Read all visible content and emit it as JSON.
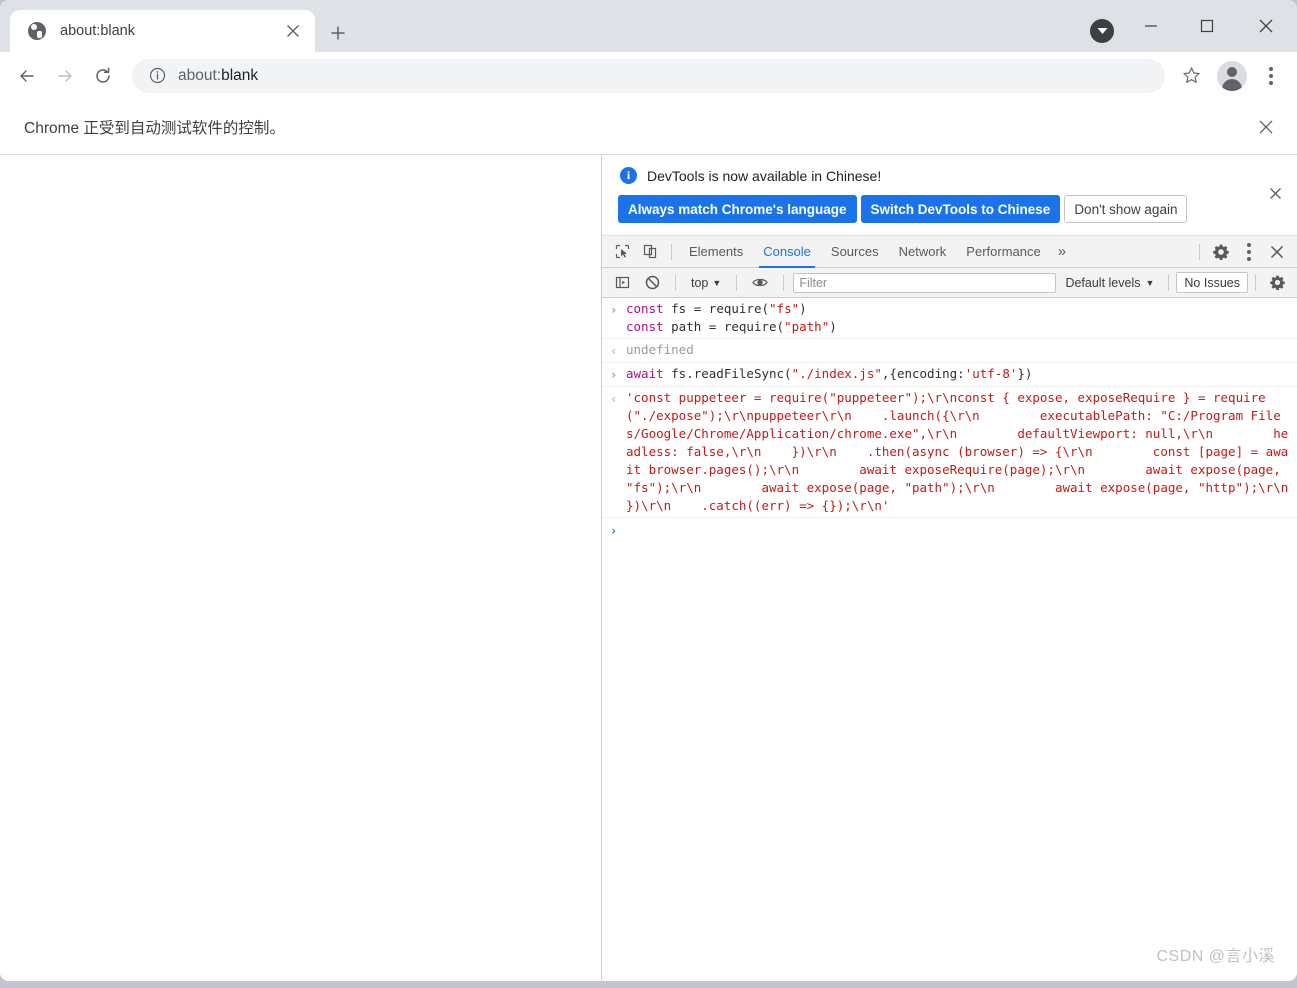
{
  "browser": {
    "tab": {
      "title": "about:blank",
      "favicon": "globe-icon",
      "close_label": "×"
    },
    "new_tab_label": "+",
    "window_controls": {
      "minimize": "—",
      "maximize": "□",
      "close": "×"
    },
    "toolbar": {
      "back": "←",
      "forward": "→",
      "reload": "⟳",
      "site_info_icon": "info-circle-icon",
      "url_scheme": "about:",
      "url_rest": "blank",
      "url_full": "about:blank",
      "bookmark_icon": "star-icon",
      "profile_icon": "avatar-icon",
      "menu_icon": "three-dot-menu-icon"
    },
    "infobar": {
      "message": "Chrome 正受到自动测试软件的控制。",
      "close_label": "×"
    }
  },
  "devtools": {
    "notification": {
      "message": "DevTools is now available in Chinese!",
      "info_icon_label": "i",
      "buttons": [
        {
          "label": "Always match Chrome's language",
          "style": "primary"
        },
        {
          "label": "Switch DevTools to Chinese",
          "style": "primary"
        },
        {
          "label": "Don't show again",
          "style": "secondary"
        }
      ],
      "close_label": "×"
    },
    "tabbar": {
      "inspect_icon": "inspect-element-icon",
      "device_icon": "device-toolbar-icon",
      "tabs": [
        {
          "label": "Elements",
          "active": false
        },
        {
          "label": "Console",
          "active": true
        },
        {
          "label": "Sources",
          "active": false
        },
        {
          "label": "Network",
          "active": false
        },
        {
          "label": "Performance",
          "active": false
        }
      ],
      "more_label": "»",
      "settings_icon": "gear-icon",
      "menu_icon": "three-dot-menu-icon",
      "close_label": "×"
    },
    "console_toolbar": {
      "sidebar_toggle_icon": "console-sidebar-icon",
      "clear_icon": "clear-console-icon",
      "context": "top",
      "context_caret": "▼",
      "eye_icon": "live-expression-icon",
      "filter_placeholder": "Filter",
      "filter_value": "",
      "levels_label": "Default levels",
      "levels_caret": "▼",
      "issues_label": "No Issues",
      "settings_icon": "gear-icon"
    },
    "console_log": [
      {
        "type": "input",
        "gutter": "›",
        "tokens": [
          {
            "t": "const ",
            "c": "kw"
          },
          {
            "t": "fs = ",
            "c": "plain"
          },
          {
            "t": "require",
            "c": "plain"
          },
          {
            "t": "(",
            "c": "punc"
          },
          {
            "t": "\"fs\"",
            "c": "str"
          },
          {
            "t": ")",
            "c": "punc"
          },
          {
            "t": "\n",
            "c": "plain"
          },
          {
            "t": "const ",
            "c": "kw"
          },
          {
            "t": "path = ",
            "c": "plain"
          },
          {
            "t": "require",
            "c": "plain"
          },
          {
            "t": "(",
            "c": "punc"
          },
          {
            "t": "\"path\"",
            "c": "str"
          },
          {
            "t": ")",
            "c": "punc"
          }
        ]
      },
      {
        "type": "output",
        "gutter": "‹",
        "tokens": [
          {
            "t": "undefined",
            "c": "undef"
          }
        ]
      },
      {
        "type": "input",
        "gutter": "›",
        "tokens": [
          {
            "t": "await ",
            "c": "kw"
          },
          {
            "t": "fs.readFileSync",
            "c": "plain"
          },
          {
            "t": "(",
            "c": "punc"
          },
          {
            "t": "\"./index.js\"",
            "c": "str"
          },
          {
            "t": ",{",
            "c": "punc"
          },
          {
            "t": "encoding",
            "c": "plain"
          },
          {
            "t": ":",
            "c": "punc"
          },
          {
            "t": "'utf-8'",
            "c": "str"
          },
          {
            "t": "})",
            "c": "punc"
          }
        ]
      },
      {
        "type": "output",
        "gutter": "‹",
        "tokens": [
          {
            "t": "'const puppeteer = require(\"puppeteer\");\\r\\nconst { expose, exposeRequire } = require(\"./expose\");\\r\\npuppeteer\\r\\n    .launch({\\r\\n        executablePath: \"C:/Program Files/Google/Chrome/Application/chrome.exe\",\\r\\n        defaultViewport: null,\\r\\n        headless: false,\\r\\n    })\\r\\n    .then(async (browser) => {\\r\\n        const [page] = await browser.pages();\\r\\n        await exposeRequire(page);\\r\\n        await expose(page, \"fs\");\\r\\n        await expose(page, \"path\");\\r\\n        await expose(page, \"http\");\\r\\n    })\\r\\n    .catch((err) => {});\\r\\n'",
            "c": "outstr"
          }
        ]
      }
    ],
    "prompt": {
      "chevron": "›",
      "value": ""
    }
  },
  "watermark": {
    "text": "CSDN @言小溪"
  },
  "colors": {
    "accent": "#1a73e8",
    "tabstrip_bg": "#dee1e6",
    "string": "#c41a16",
    "keyword": "#aa0d91",
    "desktop": "#bfc6d1"
  }
}
